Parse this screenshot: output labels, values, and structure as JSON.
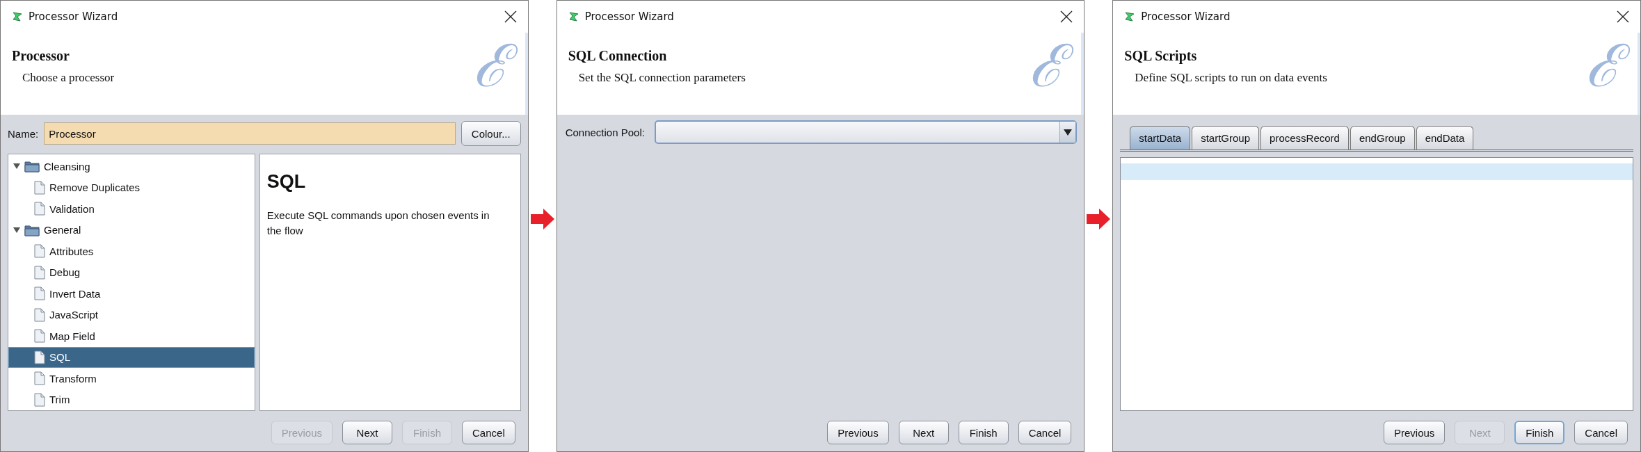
{
  "dialogs": [
    {
      "kind": "processor",
      "title": "Processor Wizard",
      "logo": "ℰ",
      "heading": "Processor",
      "subheading": "Choose a processor",
      "name_field": {
        "label": "Name:",
        "value": "Processor"
      },
      "colour_button": "Colour...",
      "tree": [
        {
          "label": "Cleansing",
          "expanded": true,
          "selected": false,
          "children": [
            {
              "label": "Remove Duplicates",
              "selected": false
            },
            {
              "label": "Validation",
              "selected": false
            }
          ]
        },
        {
          "label": "General",
          "expanded": true,
          "selected": false,
          "children": [
            {
              "label": "Attributes",
              "selected": false
            },
            {
              "label": "Debug",
              "selected": false
            },
            {
              "label": "Invert Data",
              "selected": false
            },
            {
              "label": "JavaScript",
              "selected": false
            },
            {
              "label": "Map Field",
              "selected": false
            },
            {
              "label": "SQL",
              "selected": true
            },
            {
              "label": "Transform",
              "selected": false
            },
            {
              "label": "Trim",
              "selected": false
            }
          ]
        }
      ],
      "description": {
        "title": "SQL",
        "text": "Execute SQL commands upon chosen events in the flow"
      },
      "buttons": [
        {
          "label": "Previous",
          "disabled": true,
          "focused": false
        },
        {
          "label": "Next",
          "disabled": false,
          "focused": false
        },
        {
          "label": "Finish",
          "disabled": true,
          "focused": false
        },
        {
          "label": "Cancel",
          "disabled": false,
          "focused": false
        }
      ]
    },
    {
      "kind": "connection",
      "title": "Processor Wizard",
      "logo": "ℰ",
      "heading": "SQL Connection",
      "subheading": "Set the SQL connection parameters",
      "combo": {
        "label": "Connection Pool:"
      },
      "buttons": [
        {
          "label": "Previous",
          "disabled": false,
          "focused": false
        },
        {
          "label": "Next",
          "disabled": false,
          "focused": false
        },
        {
          "label": "Finish",
          "disabled": false,
          "focused": false
        },
        {
          "label": "Cancel",
          "disabled": false,
          "focused": false
        }
      ]
    },
    {
      "kind": "scripts",
      "title": "Processor Wizard",
      "logo": "ℰ",
      "heading": "SQL Scripts",
      "subheading": "Define SQL scripts to run on data events",
      "tabs": [
        {
          "label": "startData",
          "selected": true
        },
        {
          "label": "startGroup",
          "selected": false
        },
        {
          "label": "processRecord",
          "selected": false
        },
        {
          "label": "endGroup",
          "selected": false
        },
        {
          "label": "endData",
          "selected": false
        }
      ],
      "buttons": [
        {
          "label": "Previous",
          "disabled": false,
          "focused": false
        },
        {
          "label": "Next",
          "disabled": true,
          "focused": false
        },
        {
          "label": "Finish",
          "disabled": false,
          "focused": true
        },
        {
          "label": "Cancel",
          "disabled": false,
          "focused": false
        }
      ]
    }
  ]
}
